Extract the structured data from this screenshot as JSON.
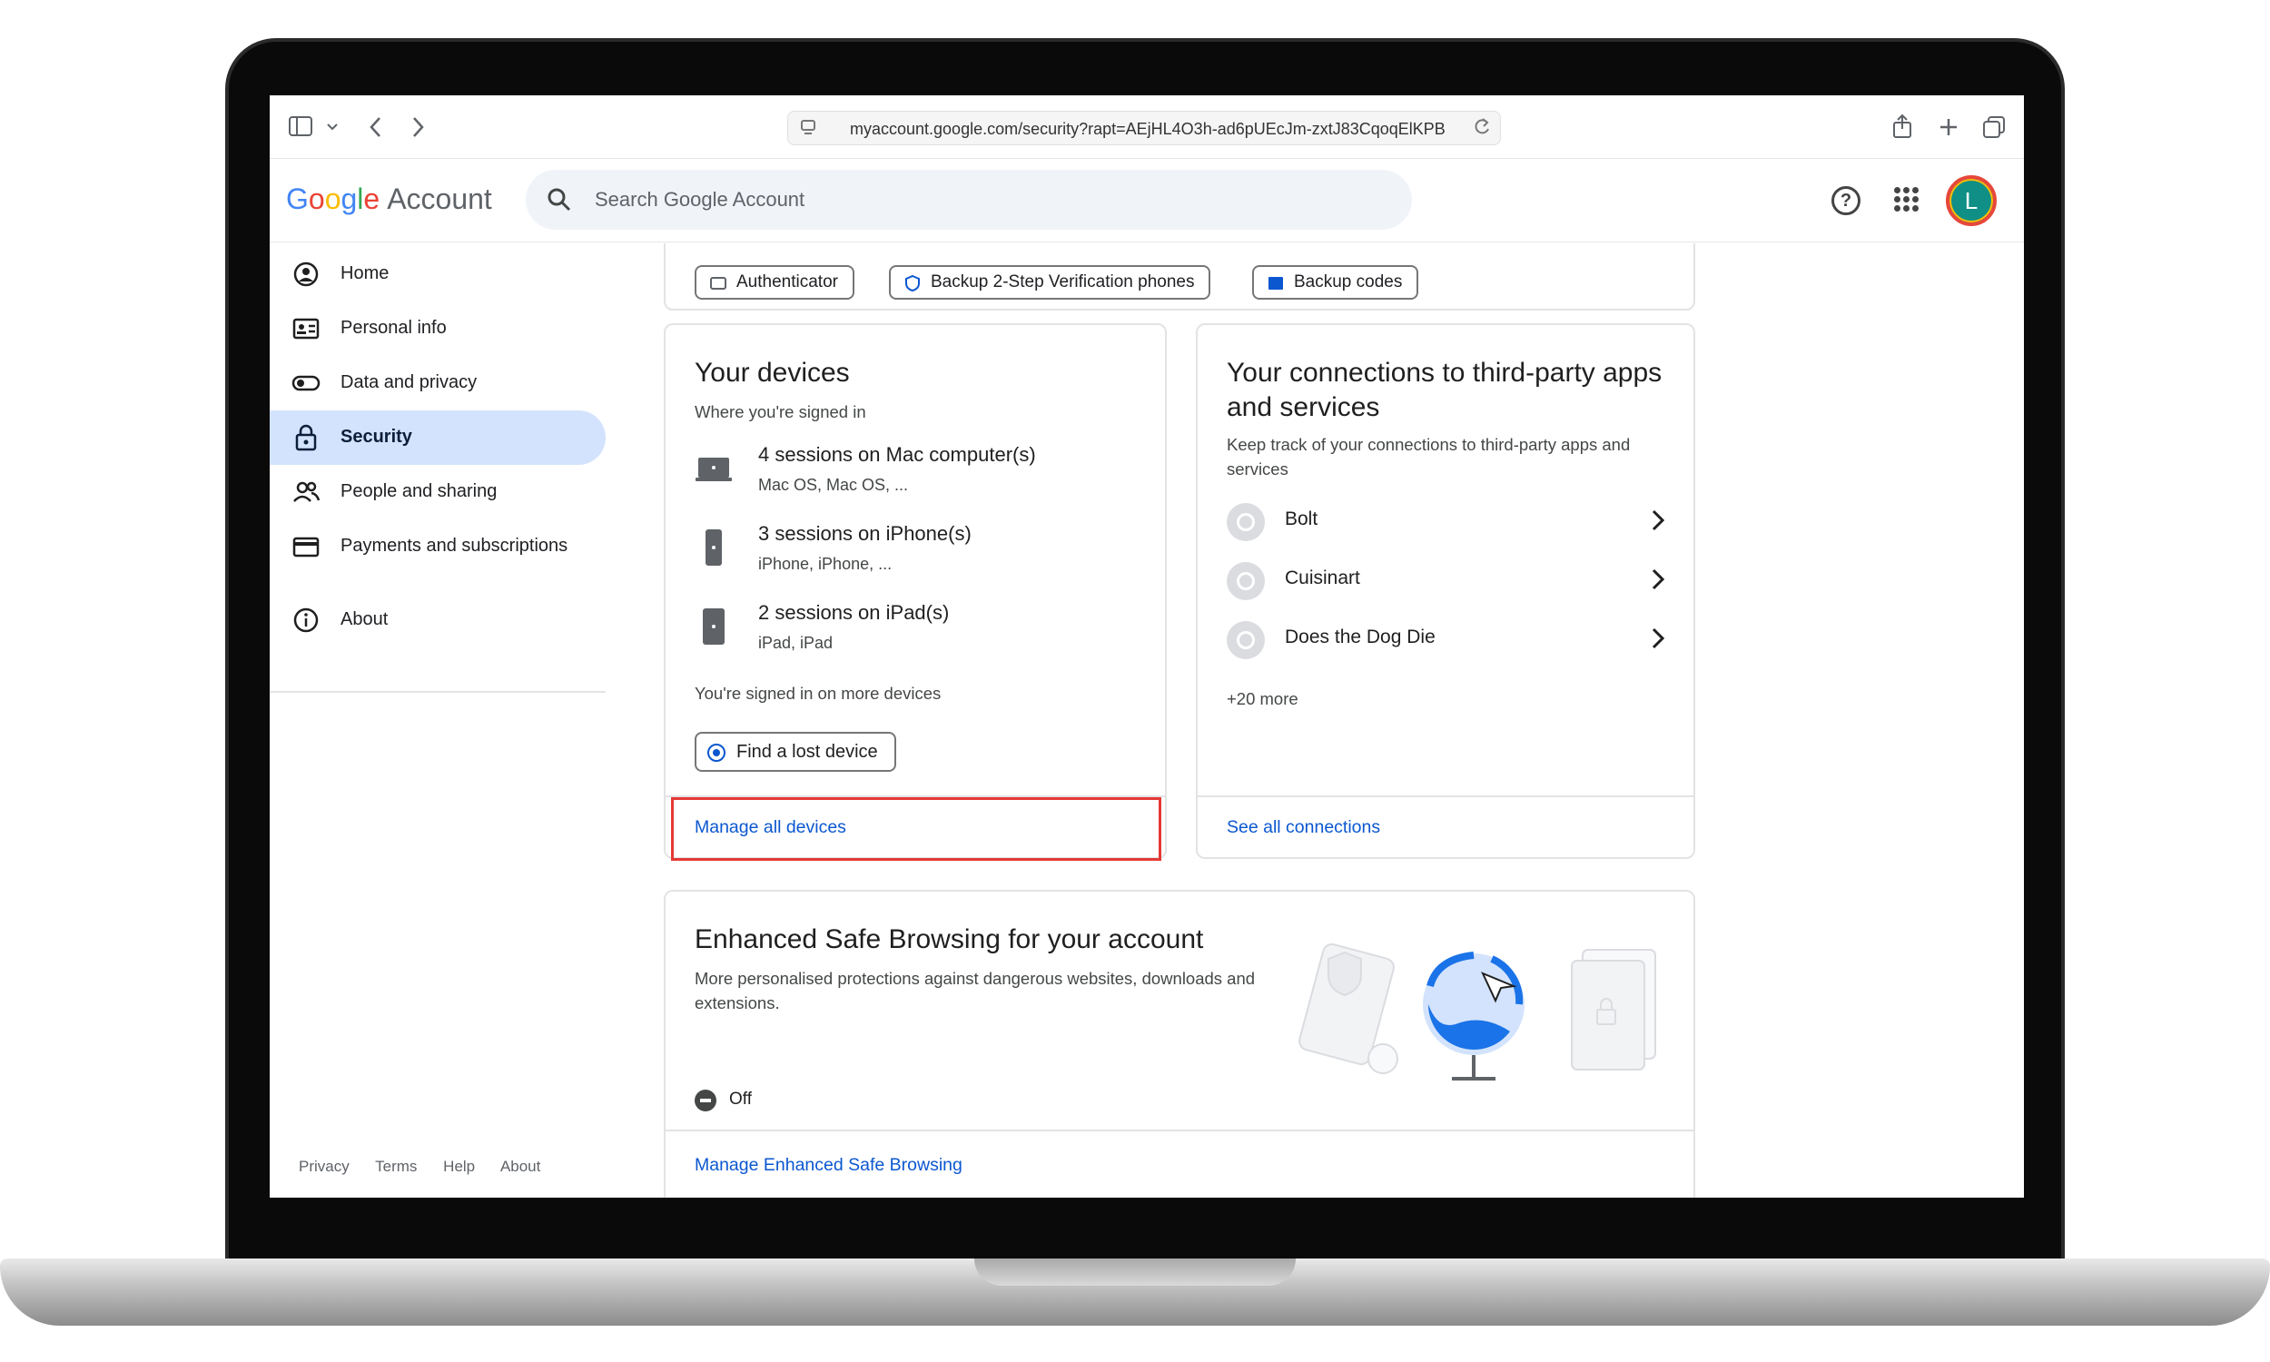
{
  "browser": {
    "url": "myaccount.google.com/security?rapt=AEjHL4O3h-ad6pUEcJm-zxtJ83CqoqElKPB"
  },
  "header": {
    "logo_google": "Google",
    "logo_account": "Account",
    "search_placeholder": "Search Google Account",
    "avatar_initial": "L"
  },
  "sidebar": {
    "items": [
      {
        "label": "Home",
        "icon": "home-icon"
      },
      {
        "label": "Personal info",
        "icon": "id-card-icon"
      },
      {
        "label": "Data and privacy",
        "icon": "toggle-icon"
      },
      {
        "label": "Security",
        "icon": "lock-icon",
        "active": true
      },
      {
        "label": "People and sharing",
        "icon": "people-icon"
      },
      {
        "label": "Payments and subscriptions",
        "icon": "credit-card-icon"
      },
      {
        "label": "About",
        "icon": "info-icon"
      }
    ],
    "footer": [
      "Privacy",
      "Terms",
      "Help",
      "About"
    ]
  },
  "two_step_chips": [
    "Authenticator",
    "Backup 2-Step Verification phones",
    "Backup codes"
  ],
  "devices": {
    "title": "Your devices",
    "subtitle": "Where you're signed in",
    "rows": [
      {
        "title": "4 sessions on Mac computer(s)",
        "sub": "Mac OS, Mac OS, ..."
      },
      {
        "title": "3 sessions on iPhone(s)",
        "sub": "iPhone, iPhone, ..."
      },
      {
        "title": "2 sessions on iPad(s)",
        "sub": "iPad, iPad"
      }
    ],
    "more_text": "You're signed in on more devices",
    "find_button": "Find a lost device",
    "manage_link": "Manage all devices"
  },
  "connections": {
    "title": "Your connections to third-party apps and services",
    "subtitle": "Keep track of your connections to third-party apps and services",
    "rows": [
      "Bolt",
      "Cuisinart",
      "Does the Dog Die"
    ],
    "more": "+20 more",
    "see_all_link": "See all connections"
  },
  "safe_browsing": {
    "title": "Enhanced Safe Browsing for your account",
    "subtitle": "More personalised protections against dangerous websites, downloads and extensions.",
    "status": "Off",
    "manage_link": "Manage Enhanced Safe Browsing"
  },
  "colors": {
    "accent_blue": "#0b57d0",
    "active_nav": "#d3e3fd",
    "highlight_red": "#e53935"
  }
}
